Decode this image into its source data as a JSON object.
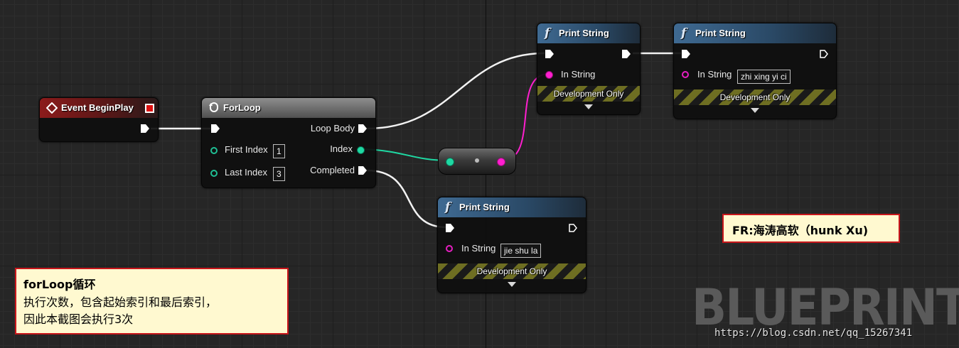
{
  "event_node": {
    "title": "Event BeginPlay"
  },
  "forloop_node": {
    "title": "ForLoop",
    "inputs": {
      "first_index_label": "First Index",
      "first_index_value": "1",
      "last_index_label": "Last Index",
      "last_index_value": "3"
    },
    "outputs": {
      "loop_body": "Loop Body",
      "index": "Index",
      "completed": "Completed"
    }
  },
  "print_string_1": {
    "title": "Print String",
    "in_string_label": "In String",
    "dev_only": "Development Only"
  },
  "print_string_2": {
    "title": "Print String",
    "in_string_label": "In String",
    "in_string_value": "zhi xing yi ci",
    "dev_only": "Development Only"
  },
  "print_string_3": {
    "title": "Print String",
    "in_string_label": "In String",
    "in_string_value": "jie shu la",
    "dev_only": "Development Only"
  },
  "note_credit": {
    "text": "FR:海涛高软（hunk Xu)"
  },
  "note_forloop": {
    "title": "forLoop循环",
    "line1": "执行次数，包含起始索引和最后索引，",
    "line2": "因此本截图会执行3次"
  },
  "watermark": "BLUEPRINT",
  "url": "https://blog.csdn.net/qq_15267341",
  "colors": {
    "exec_wire": "#ffffff",
    "int_wire": "#1fd9a3",
    "string_wire": "#ff1fcf",
    "note_border": "#c8161b",
    "note_bg": "#fff9d0"
  }
}
